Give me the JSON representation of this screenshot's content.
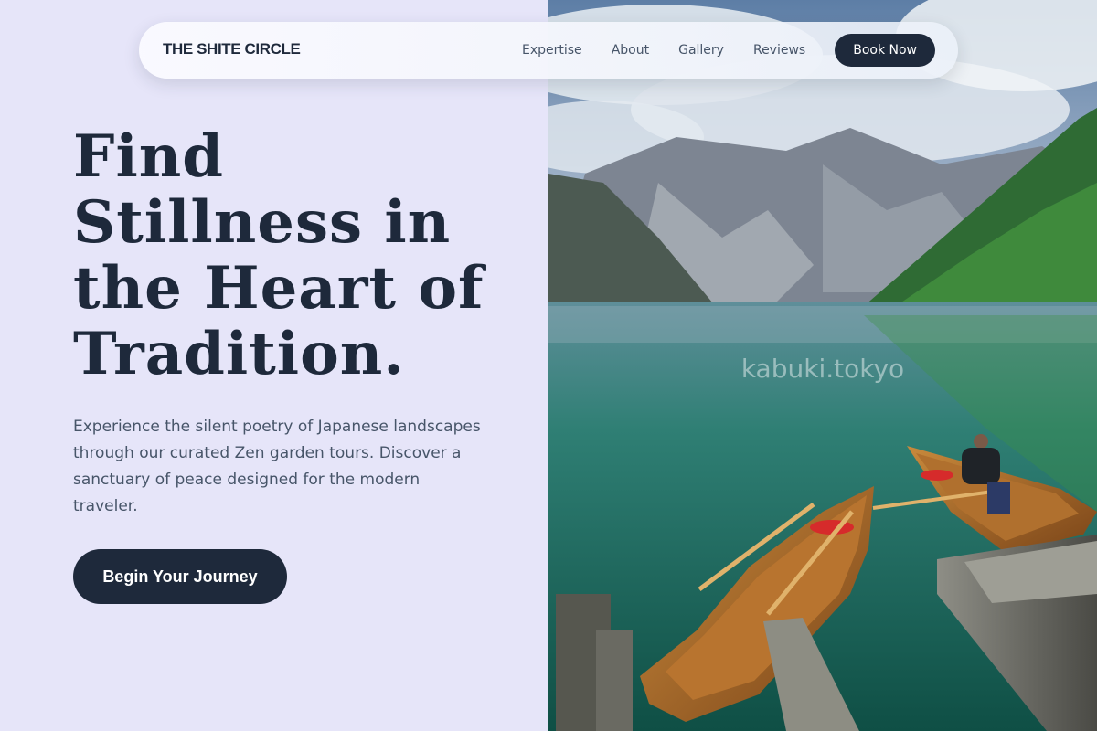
{
  "nav": {
    "brand": "THE SHITE CIRCLE",
    "links": [
      "Expertise",
      "About",
      "Gallery",
      "Reviews"
    ],
    "cta": "Book Now"
  },
  "hero": {
    "title": "Find Stillness in the Heart of Tradition.",
    "subtitle": "Experience the silent poetry of Japanese landscapes through our curated Zen garden tours. Discover a sanctuary of peace designed for the modern traveler.",
    "cta": "Begin Your Journey"
  },
  "image": {
    "watermark": "kabuki.tokyo"
  },
  "colors": {
    "background": "#e6e5f9",
    "primary": "#1e293b",
    "text_muted": "#475569"
  }
}
